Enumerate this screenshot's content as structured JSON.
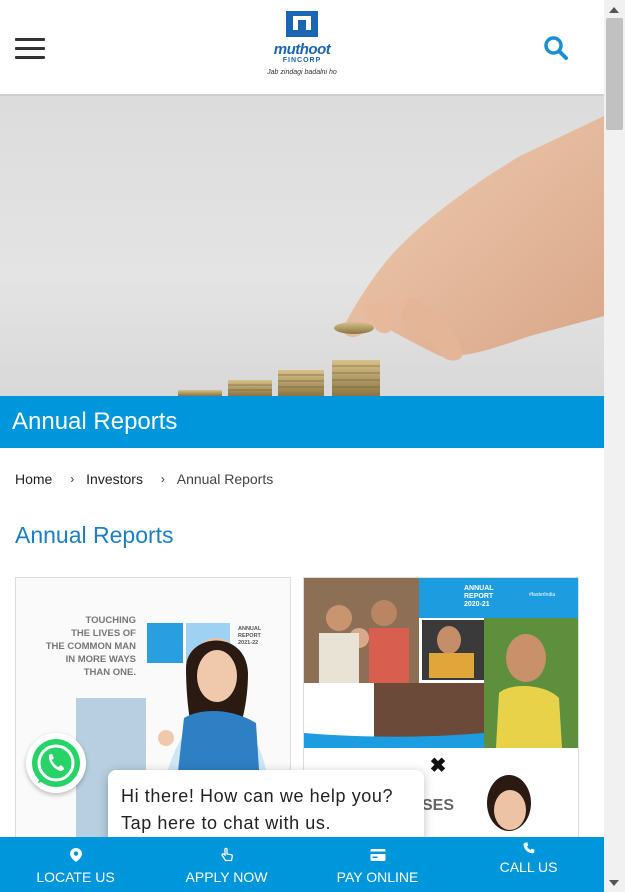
{
  "header": {
    "logo": {
      "brand": "muthoot",
      "sub": "FINCORP",
      "tagline": "Jab zindagi badalni ho"
    }
  },
  "banner": {
    "title": "Annual Reports"
  },
  "breadcrumb": {
    "home": "Home",
    "investors": "Investors",
    "current": "Annual Reports"
  },
  "section": {
    "title": "Annual Reports"
  },
  "cards": [
    {
      "lines": [
        "TOUCHING",
        "THE LIVES OF",
        "THE COMMON MAN",
        "IN MORE WAYS",
        "THAN ONE."
      ],
      "badge": [
        "ANNUAL",
        "REPORT",
        "2021-22"
      ]
    },
    {
      "badge": [
        "ANNUAL",
        "REPORT",
        "2020-21"
      ],
      "hashtag": "#fasterIndia",
      "partial": "SES"
    }
  ],
  "chat": {
    "message": "Hi there! How can we help you? Tap here to chat with us."
  },
  "bottom_nav": [
    {
      "label": "LOCATE US",
      "icon": "map-pin-icon"
    },
    {
      "label": "APPLY NOW",
      "icon": "hand-pointer-icon"
    },
    {
      "label": "PAY ONLINE",
      "icon": "credit-card-icon"
    },
    {
      "label": "CALL US",
      "icon": "phone-icon"
    }
  ],
  "colors": {
    "accent": "#0096db",
    "title_blue": "#1a7fc6",
    "whatsapp": "#25d366"
  }
}
